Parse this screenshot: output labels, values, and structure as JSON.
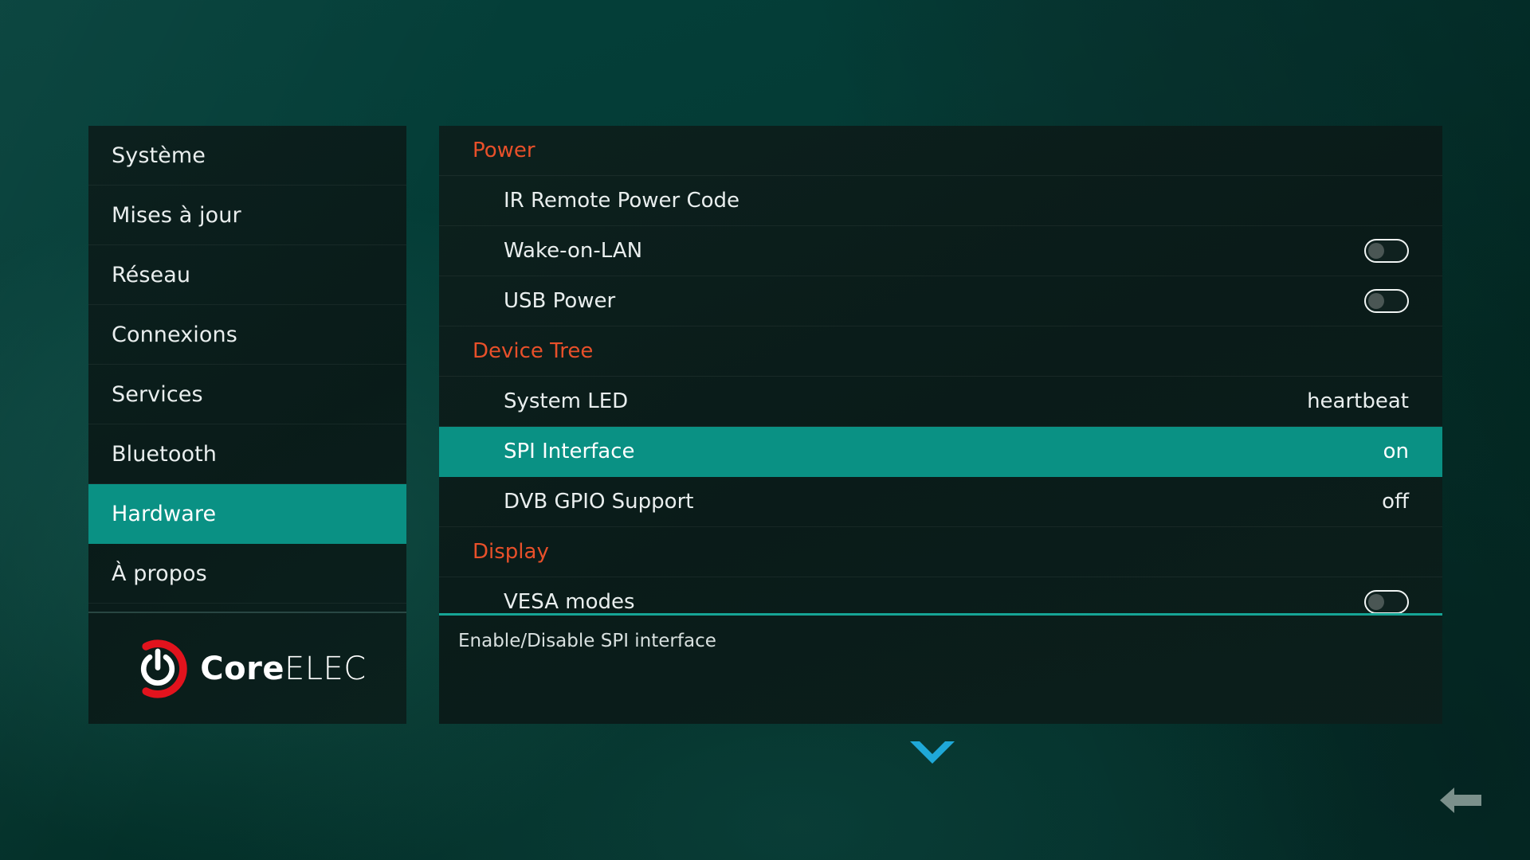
{
  "theme": {
    "accent_teal": "#0a9184",
    "group_header_orange": "#e8502a",
    "divider_teal": "#16a596",
    "text_primary": "#e9eeee",
    "background_green": "#04332e",
    "logo_red": "#e2131d",
    "chevron_blue": "#1fa8d8",
    "back_arrow_gray": "#7b908b"
  },
  "sidebar": {
    "items": [
      {
        "label": "Système",
        "name": "sidebar-item-systeme",
        "selected": false
      },
      {
        "label": "Mises à jour",
        "name": "sidebar-item-mises-a-jour",
        "selected": false
      },
      {
        "label": "Réseau",
        "name": "sidebar-item-reseau",
        "selected": false
      },
      {
        "label": "Connexions",
        "name": "sidebar-item-connexions",
        "selected": false
      },
      {
        "label": "Services",
        "name": "sidebar-item-services",
        "selected": false
      },
      {
        "label": "Bluetooth",
        "name": "sidebar-item-bluetooth",
        "selected": false
      },
      {
        "label": "Hardware",
        "name": "sidebar-item-hardware",
        "selected": true
      },
      {
        "label": "À propos",
        "name": "sidebar-item-a-propos",
        "selected": false
      }
    ],
    "brand": {
      "icon": "coreelec-power-logo-icon",
      "name_bold": "Core",
      "name_thin": "ELEC"
    }
  },
  "content": {
    "rows": [
      {
        "kind": "group",
        "label": "Power",
        "name": "group-header-power"
      },
      {
        "kind": "setting",
        "label": "IR Remote Power Code",
        "name": "setting-ir-remote-power-code",
        "control": "none",
        "value": "",
        "selected": false
      },
      {
        "kind": "setting",
        "label": "Wake-on-LAN",
        "name": "setting-wake-on-lan",
        "control": "toggle",
        "value": "off",
        "selected": false
      },
      {
        "kind": "setting",
        "label": "USB Power",
        "name": "setting-usb-power",
        "control": "toggle",
        "value": "off",
        "selected": false
      },
      {
        "kind": "group",
        "label": "Device Tree",
        "name": "group-header-device-tree"
      },
      {
        "kind": "setting",
        "label": "System LED",
        "name": "setting-system-led",
        "control": "text",
        "value": "heartbeat",
        "selected": false
      },
      {
        "kind": "setting",
        "label": "SPI Interface",
        "name": "setting-spi-interface",
        "control": "text",
        "value": "on",
        "selected": true
      },
      {
        "kind": "setting",
        "label": "DVB GPIO Support",
        "name": "setting-dvb-gpio-support",
        "control": "text",
        "value": "off",
        "selected": false
      },
      {
        "kind": "group",
        "label": "Display",
        "name": "group-header-display"
      },
      {
        "kind": "setting",
        "label": "VESA modes",
        "name": "setting-vesa-modes",
        "control": "toggle",
        "value": "off",
        "selected": false
      }
    ],
    "description": "Enable/Disable SPI interface"
  },
  "navigation": {
    "scroll_down_icon": "chevron-down-icon",
    "back_icon": "arrow-left-icon"
  }
}
